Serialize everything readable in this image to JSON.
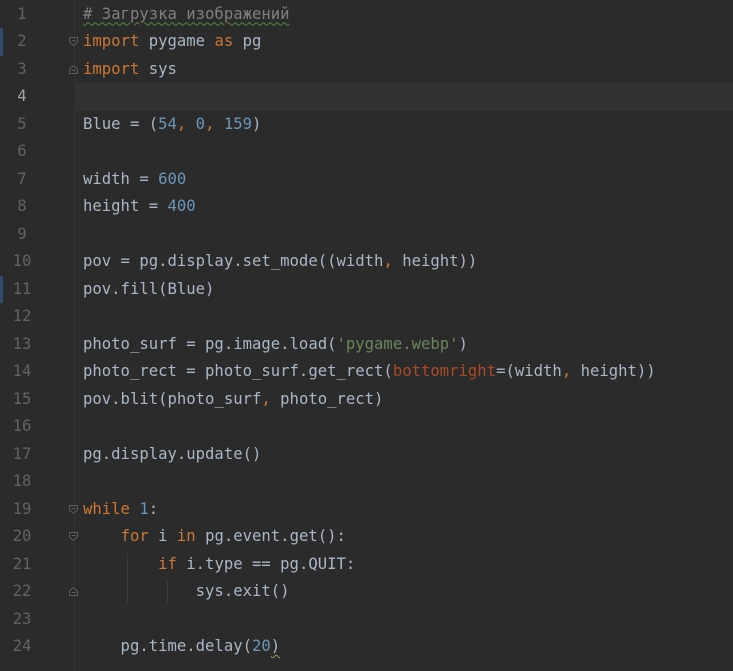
{
  "editor": {
    "language": "python",
    "current_line": 4,
    "lines": [
      {
        "n": "1",
        "tokens": [
          {
            "t": "# Загрузка изображений",
            "c": "comment squiggle"
          }
        ]
      },
      {
        "n": "2",
        "tokens": [
          {
            "t": "import",
            "c": "kw"
          },
          {
            "t": " pygame ",
            "c": ""
          },
          {
            "t": "as",
            "c": "kw"
          },
          {
            "t": " pg",
            "c": ""
          }
        ]
      },
      {
        "n": "3",
        "tokens": [
          {
            "t": "import",
            "c": "kw"
          },
          {
            "t": " sys",
            "c": ""
          }
        ]
      },
      {
        "n": "4",
        "tokens": []
      },
      {
        "n": "5",
        "tokens": [
          {
            "t": "Blue = (",
            "c": ""
          },
          {
            "t": "54",
            "c": "num"
          },
          {
            "t": ", ",
            "c": "kw"
          },
          {
            "t": "0",
            "c": "num"
          },
          {
            "t": ", ",
            "c": "kw"
          },
          {
            "t": "159",
            "c": "num"
          },
          {
            "t": ")",
            "c": ""
          }
        ]
      },
      {
        "n": "6",
        "tokens": []
      },
      {
        "n": "7",
        "tokens": [
          {
            "t": "width = ",
            "c": ""
          },
          {
            "t": "600",
            "c": "num"
          }
        ]
      },
      {
        "n": "8",
        "tokens": [
          {
            "t": "height = ",
            "c": ""
          },
          {
            "t": "400",
            "c": "num"
          }
        ]
      },
      {
        "n": "9",
        "tokens": []
      },
      {
        "n": "10",
        "tokens": [
          {
            "t": "pov = pg.display.set_mode((width",
            "c": ""
          },
          {
            "t": ", ",
            "c": "kw"
          },
          {
            "t": "height))",
            "c": ""
          }
        ]
      },
      {
        "n": "11",
        "tokens": [
          {
            "t": "pov.fill(Blue)",
            "c": ""
          }
        ]
      },
      {
        "n": "12",
        "tokens": []
      },
      {
        "n": "13",
        "tokens": [
          {
            "t": "photo_surf = pg.image.load(",
            "c": ""
          },
          {
            "t": "'pygame.webp'",
            "c": "str"
          },
          {
            "t": ")",
            "c": ""
          }
        ]
      },
      {
        "n": "14",
        "tokens": [
          {
            "t": "photo_rect = photo_surf.get_rect(",
            "c": ""
          },
          {
            "t": "bottomright",
            "c": "param"
          },
          {
            "t": "=(width",
            "c": ""
          },
          {
            "t": ", ",
            "c": "kw"
          },
          {
            "t": "height))",
            "c": ""
          }
        ]
      },
      {
        "n": "15",
        "tokens": [
          {
            "t": "pov.blit(photo_surf",
            "c": ""
          },
          {
            "t": ", ",
            "c": "kw"
          },
          {
            "t": "photo_rect)",
            "c": ""
          }
        ]
      },
      {
        "n": "16",
        "tokens": []
      },
      {
        "n": "17",
        "tokens": [
          {
            "t": "pg.display.update()",
            "c": ""
          }
        ]
      },
      {
        "n": "18",
        "tokens": []
      },
      {
        "n": "19",
        "tokens": [
          {
            "t": "while ",
            "c": "kw"
          },
          {
            "t": "1",
            "c": "num"
          },
          {
            "t": ":",
            "c": ""
          }
        ]
      },
      {
        "n": "20",
        "tokens": [
          {
            "t": "    ",
            "c": ""
          },
          {
            "t": "for",
            "c": "kw"
          },
          {
            "t": " i ",
            "c": ""
          },
          {
            "t": "in",
            "c": "kw"
          },
          {
            "t": " pg.event.get():",
            "c": ""
          }
        ]
      },
      {
        "n": "21",
        "tokens": [
          {
            "t": "        ",
            "c": ""
          },
          {
            "t": "if",
            "c": "kw"
          },
          {
            "t": " i.type == pg.QUIT:",
            "c": ""
          }
        ]
      },
      {
        "n": "22",
        "tokens": [
          {
            "t": "            sys.exit()",
            "c": ""
          }
        ]
      },
      {
        "n": "23",
        "tokens": []
      },
      {
        "n": "24",
        "tokens": [
          {
            "t": "    pg.time.delay(",
            "c": ""
          },
          {
            "t": "20",
            "c": "num"
          },
          {
            "t": ")",
            "c": "squiggle-light"
          }
        ]
      }
    ],
    "fold_markers": [
      {
        "line": 2,
        "kind": "open"
      },
      {
        "line": 3,
        "kind": "close"
      },
      {
        "line": 19,
        "kind": "open"
      },
      {
        "line": 20,
        "kind": "open"
      },
      {
        "line": 22,
        "kind": "close"
      }
    ],
    "change_markers": [
      2,
      11
    ]
  }
}
